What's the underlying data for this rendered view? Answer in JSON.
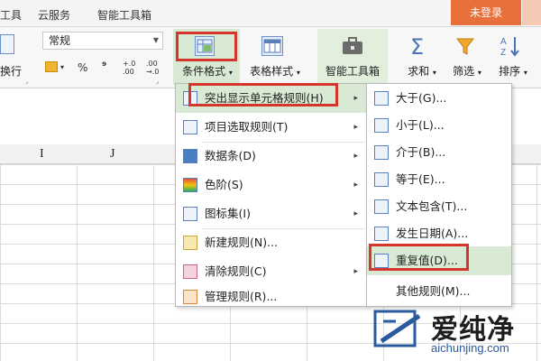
{
  "menubar": {
    "tabs": [
      "工具",
      "云服务",
      "智能工具箱"
    ],
    "login_label": "未登录"
  },
  "ribbon": {
    "wrap_label": "换行",
    "number_format": "常规",
    "percent": "%",
    "thousands": "⁹",
    "inc_decimal": "+.0 .00",
    "dec_decimal": ".00 →.0",
    "buttons": {
      "conditional_format": "条件格式",
      "table_style": "表格样式",
      "smart_toolbox": "智能工具箱",
      "sum": "求和",
      "filter": "筛选",
      "sort": "排序"
    }
  },
  "sheet": {
    "col_headers": [
      "I",
      "J"
    ]
  },
  "cf_menu": {
    "items": [
      {
        "label": "突出显示单元格规则(H)",
        "submenu": true
      },
      {
        "label": "项目选取规则(T)",
        "submenu": true
      },
      {
        "label": "数据条(D)",
        "submenu": true
      },
      {
        "label": "色阶(S)",
        "submenu": true
      },
      {
        "label": "图标集(I)",
        "submenu": true
      },
      {
        "label": "新建规则(N)..."
      },
      {
        "label": "清除规则(C)",
        "submenu": true
      },
      {
        "label": "管理规则(R)..."
      }
    ]
  },
  "highlight_menu": {
    "items": [
      {
        "label": "大于(G)..."
      },
      {
        "label": "小于(L)..."
      },
      {
        "label": "介于(B)..."
      },
      {
        "label": "等于(E)..."
      },
      {
        "label": "文本包含(T)..."
      },
      {
        "label": "发生日期(A)..."
      },
      {
        "label": "重复值(D)..."
      },
      {
        "label": "其他规则(M)..."
      }
    ]
  },
  "watermark": {
    "text": "爱纯净",
    "url": "aichunjing.com"
  },
  "colors": {
    "accent": "#e8703a",
    "highlight_box": "#d6352b",
    "selected_btn": "#d8ead3"
  }
}
